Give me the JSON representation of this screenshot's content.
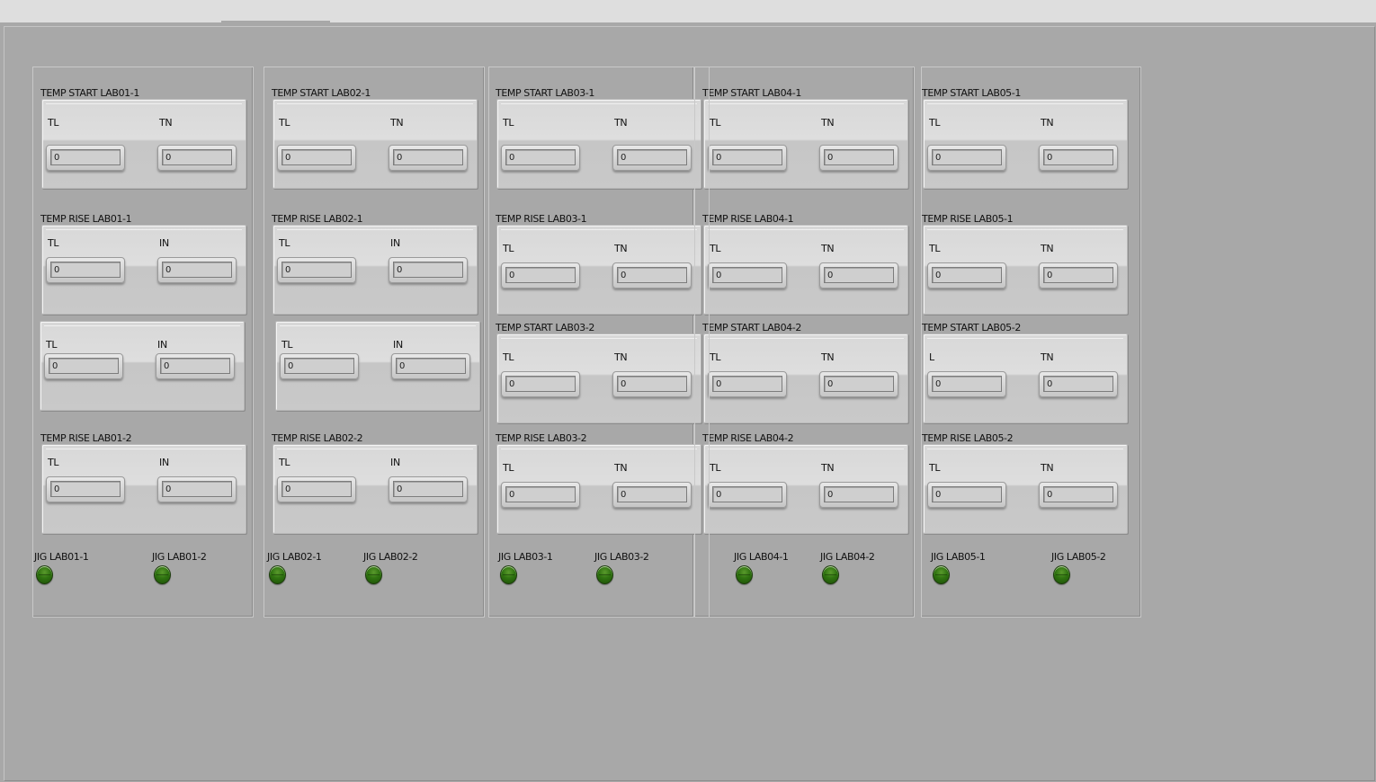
{
  "field_labels": {
    "tl": "TL",
    "tn": "TN",
    "in": "IN",
    "l": "L"
  },
  "colors": {
    "background": "#a8a8a8",
    "led_on": "#2f7310"
  },
  "labs": [
    {
      "start_1": {
        "title": "TEMP START LAB01-1",
        "tl": "0",
        "tn": "0"
      },
      "rise_1": {
        "title": "TEMP RISE LAB01-1",
        "tl": "0",
        "tn": "0"
      },
      "start_2": {
        "title": "",
        "tl": "0",
        "tn": "0"
      },
      "rise_2": {
        "title": "TEMP RISE LAB01-2",
        "tl": "0",
        "tn": "0"
      },
      "jig_1": "JIG LAB01-1",
      "jig_2": "JIG LAB01-2"
    },
    {
      "start_1": {
        "title": "TEMP START LAB02-1",
        "tl": "0",
        "tn": "0"
      },
      "rise_1": {
        "title": "TEMP RISE LAB02-1",
        "tl": "0",
        "tn": "0"
      },
      "start_2": {
        "title": "",
        "tl": "0",
        "tn": "0"
      },
      "rise_2": {
        "title": "TEMP RISE LAB02-2",
        "tl": "0",
        "tn": "0"
      },
      "jig_1": "JIG LAB02-1",
      "jig_2": "JIG LAB02-2"
    },
    {
      "start_1": {
        "title": "TEMP START LAB03-1",
        "tl": "0",
        "tn": "0"
      },
      "rise_1": {
        "title": "TEMP RISE LAB03-1",
        "tl": "0",
        "tn": "0"
      },
      "start_2": {
        "title": "TEMP START LAB03-2",
        "tl": "0",
        "tn": "0"
      },
      "rise_2": {
        "title": "TEMP RISE LAB03-2",
        "tl": "0",
        "tn": "0"
      },
      "jig_1": "JIG LAB03-1",
      "jig_2": "JIG LAB03-2"
    },
    {
      "start_1": {
        "title": "TEMP START LAB04-1",
        "tl": "0",
        "tn": "0"
      },
      "rise_1": {
        "title": "TEMP RISE LAB04-1",
        "tl": "0",
        "tn": "0"
      },
      "start_2": {
        "title": "TEMP START LAB04-2",
        "tl": "0",
        "tn": "0"
      },
      "rise_2": {
        "title": "TEMP RISE LAB04-2",
        "tl": "0",
        "tn": "0"
      },
      "jig_1": "JIG LAB04-1",
      "jig_2": "JIG LAB04-2"
    },
    {
      "start_1": {
        "title": "TEMP START LAB05-1",
        "tl": "0",
        "tn": "0"
      },
      "rise_1": {
        "title": "TEMP RISE LAB05-1",
        "tl": "0",
        "tn": "0"
      },
      "start_2": {
        "title": "TEMP START LAB05-2",
        "tl": "0",
        "tn": "0"
      },
      "rise_2": {
        "title": "TEMP RISE LAB05-2",
        "tl": "0",
        "tn": "0"
      },
      "jig_1": "JIG LAB05-1",
      "jig_2": "JIG LAB05-2"
    }
  ]
}
